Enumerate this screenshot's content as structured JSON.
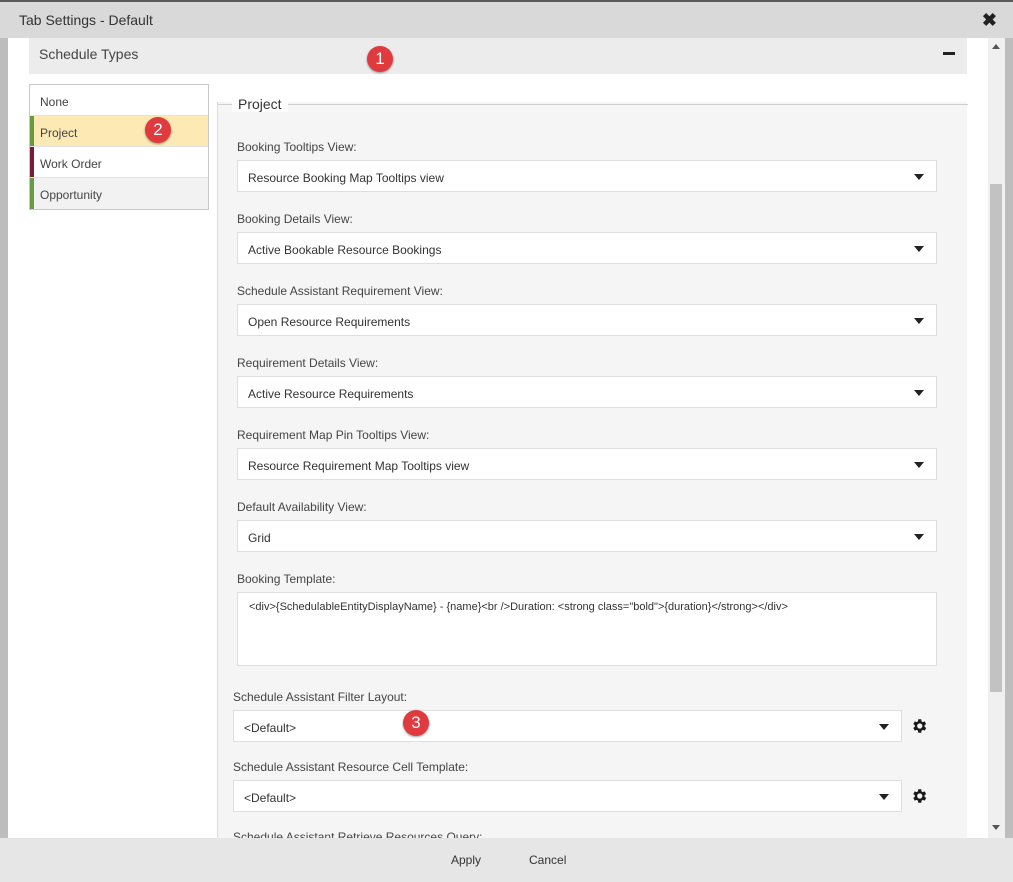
{
  "window": {
    "title": "Tab Settings - Default",
    "close_glyph": "✖"
  },
  "section": {
    "title": "Schedule Types"
  },
  "badges": [
    "1",
    "2",
    "3"
  ],
  "schedule_types": [
    {
      "label": "None",
      "color": ""
    },
    {
      "label": "Project",
      "color": "#6a9a3f",
      "selected": true
    },
    {
      "label": "Work Order",
      "color": "#7a1a3a"
    },
    {
      "label": "Opportunity",
      "color": "#6a9a3f"
    }
  ],
  "panel": {
    "legend": "Project",
    "fields": [
      {
        "label": "Booking Tooltips View:",
        "value": "Resource Booking Map Tooltips view"
      },
      {
        "label": "Booking Details View:",
        "value": "Active Bookable Resource Bookings"
      },
      {
        "label": "Schedule Assistant Requirement View:",
        "value": "Open Resource Requirements"
      },
      {
        "label": "Requirement Details View:",
        "value": "Active Resource Requirements"
      },
      {
        "label": "Requirement Map Pin Tooltips View:",
        "value": "Resource Requirement Map Tooltips view"
      },
      {
        "label": "Default Availability View:",
        "value": "Grid"
      }
    ],
    "booking_template": {
      "label": "Booking Template:",
      "value": "<div>{SchedulableEntityDisplayName} - {name}<br />Duration: <strong class=\"bold\">{duration}</strong></div>"
    },
    "filter_layout": {
      "label": "Schedule Assistant Filter Layout:",
      "value": "<Default>"
    },
    "cell_template": {
      "label": "Schedule Assistant Resource Cell Template:",
      "value": "<Default>"
    },
    "next_label_partial": "Schedule Assistant Retrieve Resources Query:"
  },
  "footer": {
    "apply": "Apply",
    "cancel": "Cancel"
  },
  "colors": {
    "badge": "#e0393e",
    "selected_bg": "#fde9b4"
  }
}
